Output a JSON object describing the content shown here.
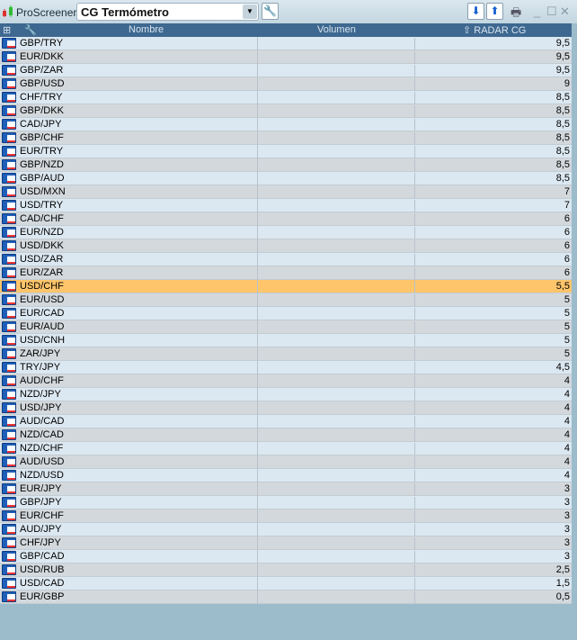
{
  "toolbar": {
    "brand": "ProScreener",
    "screener_name": "CG Termómetro"
  },
  "header": {
    "name": "Nombre",
    "volume": "Volumen",
    "radar": "RADAR CG"
  },
  "rows": [
    {
      "name": "GBP/TRY",
      "value": "9,5"
    },
    {
      "name": "EUR/DKK",
      "value": "9,5"
    },
    {
      "name": "GBP/ZAR",
      "value": "9,5"
    },
    {
      "name": "GBP/USD",
      "value": "9"
    },
    {
      "name": "CHF/TRY",
      "value": "8,5"
    },
    {
      "name": "GBP/DKK",
      "value": "8,5"
    },
    {
      "name": "CAD/JPY",
      "value": "8,5"
    },
    {
      "name": "GBP/CHF",
      "value": "8,5"
    },
    {
      "name": "EUR/TRY",
      "value": "8,5"
    },
    {
      "name": "GBP/NZD",
      "value": "8,5"
    },
    {
      "name": "GBP/AUD",
      "value": "8,5"
    },
    {
      "name": "USD/MXN",
      "value": "7"
    },
    {
      "name": "USD/TRY",
      "value": "7"
    },
    {
      "name": "CAD/CHF",
      "value": "6"
    },
    {
      "name": "EUR/NZD",
      "value": "6"
    },
    {
      "name": "USD/DKK",
      "value": "6"
    },
    {
      "name": "USD/ZAR",
      "value": "6"
    },
    {
      "name": "EUR/ZAR",
      "value": "6"
    },
    {
      "name": "USD/CHF",
      "value": "5,5",
      "selected": true
    },
    {
      "name": "EUR/USD",
      "value": "5"
    },
    {
      "name": "EUR/CAD",
      "value": "5"
    },
    {
      "name": "EUR/AUD",
      "value": "5"
    },
    {
      "name": "USD/CNH",
      "value": "5"
    },
    {
      "name": "ZAR/JPY",
      "value": "5"
    },
    {
      "name": "TRY/JPY",
      "value": "4,5"
    },
    {
      "name": "AUD/CHF",
      "value": "4"
    },
    {
      "name": "NZD/JPY",
      "value": "4"
    },
    {
      "name": "USD/JPY",
      "value": "4"
    },
    {
      "name": "AUD/CAD",
      "value": "4"
    },
    {
      "name": "NZD/CAD",
      "value": "4"
    },
    {
      "name": "NZD/CHF",
      "value": "4"
    },
    {
      "name": "AUD/USD",
      "value": "4"
    },
    {
      "name": "NZD/USD",
      "value": "4"
    },
    {
      "name": "EUR/JPY",
      "value": "3"
    },
    {
      "name": "GBP/JPY",
      "value": "3"
    },
    {
      "name": "EUR/CHF",
      "value": "3"
    },
    {
      "name": "AUD/JPY",
      "value": "3"
    },
    {
      "name": "CHF/JPY",
      "value": "3"
    },
    {
      "name": "GBP/CAD",
      "value": "3"
    },
    {
      "name": "USD/RUB",
      "value": "2,5"
    },
    {
      "name": "USD/CAD",
      "value": "1,5"
    },
    {
      "name": "EUR/GBP",
      "value": "0,5"
    }
  ]
}
